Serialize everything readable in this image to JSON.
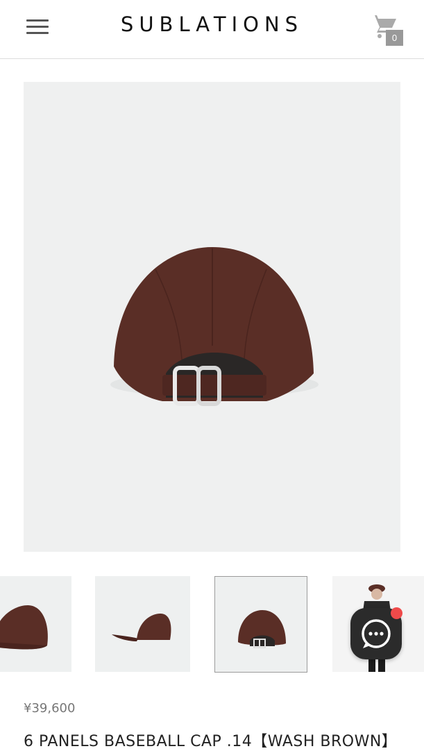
{
  "header": {
    "brand": "SUBLATIONS",
    "cart_count": "0"
  },
  "icons": {
    "menu": "hamburger-menu-icon",
    "cart": "shopping-cart-icon",
    "chat": "chat-bubble-icon"
  },
  "product": {
    "price": "¥39,600",
    "title": "6 PANELS BASEBALL CAP .14【WASH BROWN】",
    "color_hex": "#5a2e26"
  },
  "colors": {
    "notification_dot": "#ef4a4a",
    "chat_button": "#2b2b2b"
  }
}
